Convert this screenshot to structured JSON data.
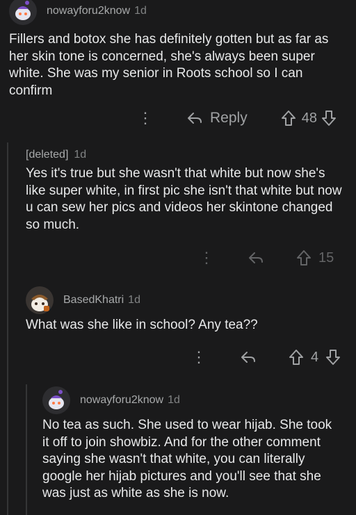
{
  "comments": [
    {
      "username": "nowayforu2know",
      "time": "1d",
      "body": "Fillers and botox she has definitely gotten but as far as her skin tone is concerned, she's always been super white. She was my senior in Roots school so I can confirm",
      "reply_label": "Reply",
      "votes": "48"
    },
    {
      "username": "[deleted]",
      "time": "1d",
      "body": "Yes it's true but she wasn't that white but now she's like super white, in first pic she isn't that white but now u can sew her pics and videos her skintone changed so much.",
      "votes": "15"
    },
    {
      "username": "BasedKhatri",
      "time": "1d",
      "body": "What was she like in school? Any tea??",
      "votes": "4"
    },
    {
      "username": "nowayforu2know",
      "time": "1d",
      "body": "No tea as such. She used to wear hijab. She took it off to join showbiz. And for the other comment saying she wasn't that white, you can literally google her hijab pictures and you'll see that she was just as white as she is now."
    }
  ],
  "icons": {
    "more": "more-options-icon",
    "reply": "reply-arrow-icon",
    "upvote": "upvote-arrow-icon",
    "downvote": "downvote-arrow-icon"
  },
  "colors": {
    "background": "#1a1a1b",
    "text": "#e8e9ea",
    "muted": "#818384",
    "thread_line": "#343536"
  }
}
